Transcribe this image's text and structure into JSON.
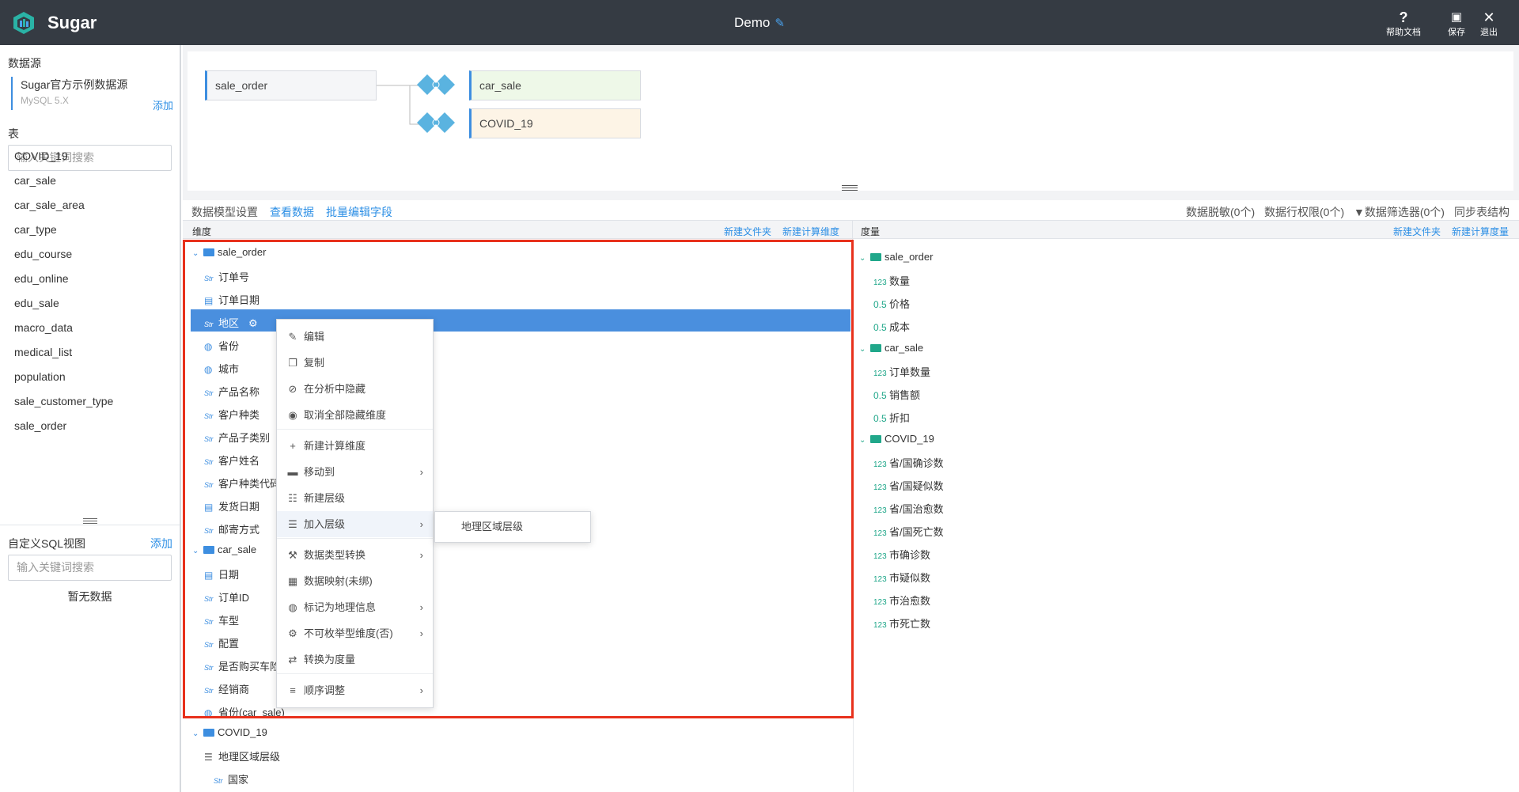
{
  "app": {
    "brand": "Sugar",
    "title": "Demo"
  },
  "topbar": {
    "help": "帮助文档",
    "save": "保存",
    "exit": "退出"
  },
  "left": {
    "datasource_title": "数据源",
    "datasource_name": "Sugar官方示例数据源",
    "datasource_type": "MySQL 5.X",
    "add_label": "添加",
    "table_title": "表",
    "search_placeholder": "输入关键词搜索",
    "tables": [
      "COVID_19",
      "car_sale",
      "car_sale_area",
      "car_type",
      "edu_course",
      "edu_online",
      "edu_sale",
      "macro_data",
      "medical_list",
      "population",
      "sale_customer_type",
      "sale_order"
    ],
    "sql_title": "自定义SQL视图",
    "sql_add": "添加",
    "sql_search_placeholder": "输入关键词搜索",
    "sql_empty": "暂无数据"
  },
  "canvas": {
    "main": "sale_order",
    "join1": "car_sale",
    "join2": "COVID_19",
    "colors": {
      "join1": "#eef8e8",
      "join2": "#fdf4e6"
    }
  },
  "toolbar": {
    "settings": "数据模型设置",
    "view": "查看数据",
    "batch": "批量编辑字段",
    "mask": "数据脱敏(0个)",
    "rowperm": "数据行权限(0个)",
    "filter": "数据筛选器(0个)",
    "sync": "同步表结构"
  },
  "dim": {
    "header": "维度",
    "new_folder": "新建文件夹",
    "new_calc": "新建计算维度"
  },
  "mea": {
    "header": "度量",
    "new_folder": "新建文件夹",
    "new_calc": "新建计算度量"
  },
  "dim_tree": {
    "sale_order": "sale_order",
    "sale_order_fields": [
      "订单号",
      "订单日期",
      "地区",
      "省份",
      "城市",
      "产品名称",
      "客户种类",
      "产品子类别",
      "客户姓名",
      "客户种类代码",
      "发货日期",
      "邮寄方式"
    ],
    "car_sale": "car_sale",
    "car_sale_fields": [
      "日期",
      "订单ID",
      "车型",
      "配置",
      "是否购买车险",
      "经销商",
      "省份(car_sale)"
    ],
    "covid": "COVID_19",
    "covid_hier": "地理区域层级",
    "covid_country": "国家",
    "type_str": "Str"
  },
  "mea_tree": {
    "sale_order": "sale_order",
    "sale_order_fields": [
      "数量",
      "价格",
      "成本"
    ],
    "car_sale": "car_sale",
    "car_sale_fields": [
      "订单数量",
      "销售额",
      "折扣"
    ],
    "covid": "COVID_19",
    "covid_fields": [
      "省/国确诊数",
      "省/国疑似数",
      "省/国治愈数",
      "省/国死亡数",
      "市确诊数",
      "市疑似数",
      "市治愈数",
      "市死亡数"
    ],
    "type_123": "123",
    "type_05": "0.5"
  },
  "menu": {
    "items": [
      "编辑",
      "复制",
      "在分析中隐藏",
      "取消全部隐藏维度",
      "新建计算维度",
      "移动到",
      "新建层级",
      "加入层级",
      "数据类型转换",
      "数据映射(未绑)",
      "标记为地理信息",
      "不可枚举型维度(否)",
      "转换为度量",
      "顺序调整"
    ],
    "submenu": "地理区域层级"
  }
}
